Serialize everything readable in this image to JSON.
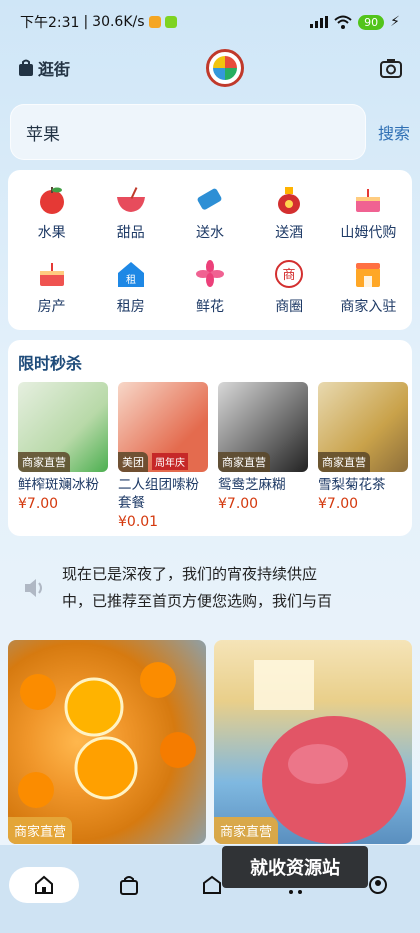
{
  "status": {
    "time": "下午2:31",
    "speed": "30.6K/s",
    "battery": "90"
  },
  "topbar": {
    "shop_label": "逛街"
  },
  "search": {
    "query": "苹果",
    "button_label": "搜索"
  },
  "categories": [
    {
      "label": "水果",
      "icon": "apple-icon"
    },
    {
      "label": "甜品",
      "icon": "dessert-icon"
    },
    {
      "label": "送水",
      "icon": "water-ticket-icon"
    },
    {
      "label": "送酒",
      "icon": "liquor-icon"
    },
    {
      "label": "山姆代购",
      "icon": "cake-icon"
    },
    {
      "label": "房产",
      "icon": "house-cake-icon"
    },
    {
      "label": "租房",
      "icon": "rent-icon"
    },
    {
      "label": "鲜花",
      "icon": "flower-icon"
    },
    {
      "label": "商圈",
      "icon": "mall-icon"
    },
    {
      "label": "商家入驻",
      "icon": "store-icon"
    }
  ],
  "flash_sale": {
    "title": "限时秒杀",
    "items": [
      {
        "tag": "商家直营",
        "name": "鲜榨斑斓冰粉",
        "price": "¥7.00",
        "image_color": "#b8d9a8"
      },
      {
        "tag": "美团",
        "name": "二人组团嗦粉套餐",
        "price": "¥0.01",
        "image_color": "#e46b4e",
        "banner": "周年庆"
      },
      {
        "tag": "商家直营",
        "name": "鸳鸯芝麻糊",
        "price": "¥7.00",
        "image_color": "#6c6c6c"
      },
      {
        "tag": "商家直营",
        "name": "雪梨菊花茶",
        "price": "¥7.00",
        "image_color": "#c9a24a"
      }
    ]
  },
  "notice": {
    "line1": "现在已是深夜了，我们的宵夜持续供应",
    "line2": "中，已推荐至首页方便您选购，我们与百"
  },
  "feed": [
    {
      "tag": "商家直营",
      "image_color": "#f0962a"
    },
    {
      "tag": "商家直营",
      "image_color": "#e25566"
    }
  ],
  "watermark": "就收资源站",
  "colors": {
    "accent": "#2f6fb4",
    "price": "#d4380d"
  }
}
